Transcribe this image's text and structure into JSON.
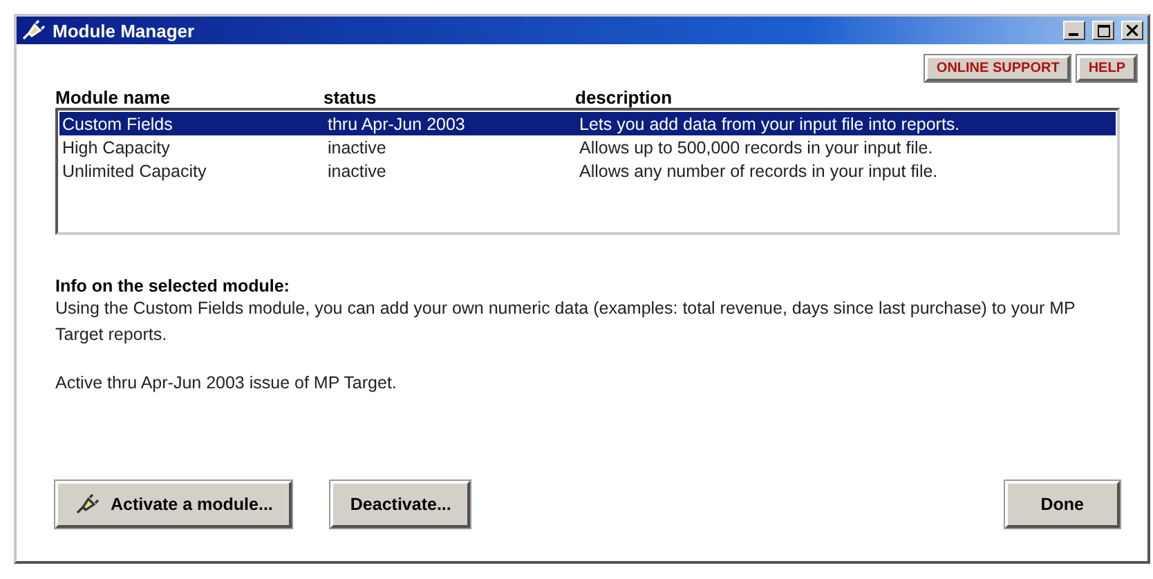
{
  "window": {
    "title": "Module Manager"
  },
  "top_buttons": [
    "ONLINE SUPPORT",
    "HELP"
  ],
  "table": {
    "columns": [
      "Module name",
      "status",
      "description"
    ],
    "rows": [
      {
        "cells": [
          "Custom Fields",
          "thru Apr-Jun 2003",
          "Lets you add data from your input file into reports."
        ],
        "selected": true
      },
      {
        "cells": [
          "High Capacity",
          "inactive",
          "Allows up to 500,000 records in your input file."
        ],
        "selected": false
      },
      {
        "cells": [
          "Unlimited Capacity",
          "inactive",
          "Allows any number of records in your input file."
        ],
        "selected": false
      }
    ]
  },
  "info": {
    "heading": "Info on the selected module:",
    "description": "Using the Custom Fields module, you can add your own numeric data (examples: total revenue, days since last purchase) to your MP Target reports.",
    "active_note": "Active thru Apr-Jun 2003 issue of MP Target."
  },
  "buttons": {
    "activate": "Activate a module...",
    "deactivate": "Deactivate...",
    "done": "Done"
  }
}
